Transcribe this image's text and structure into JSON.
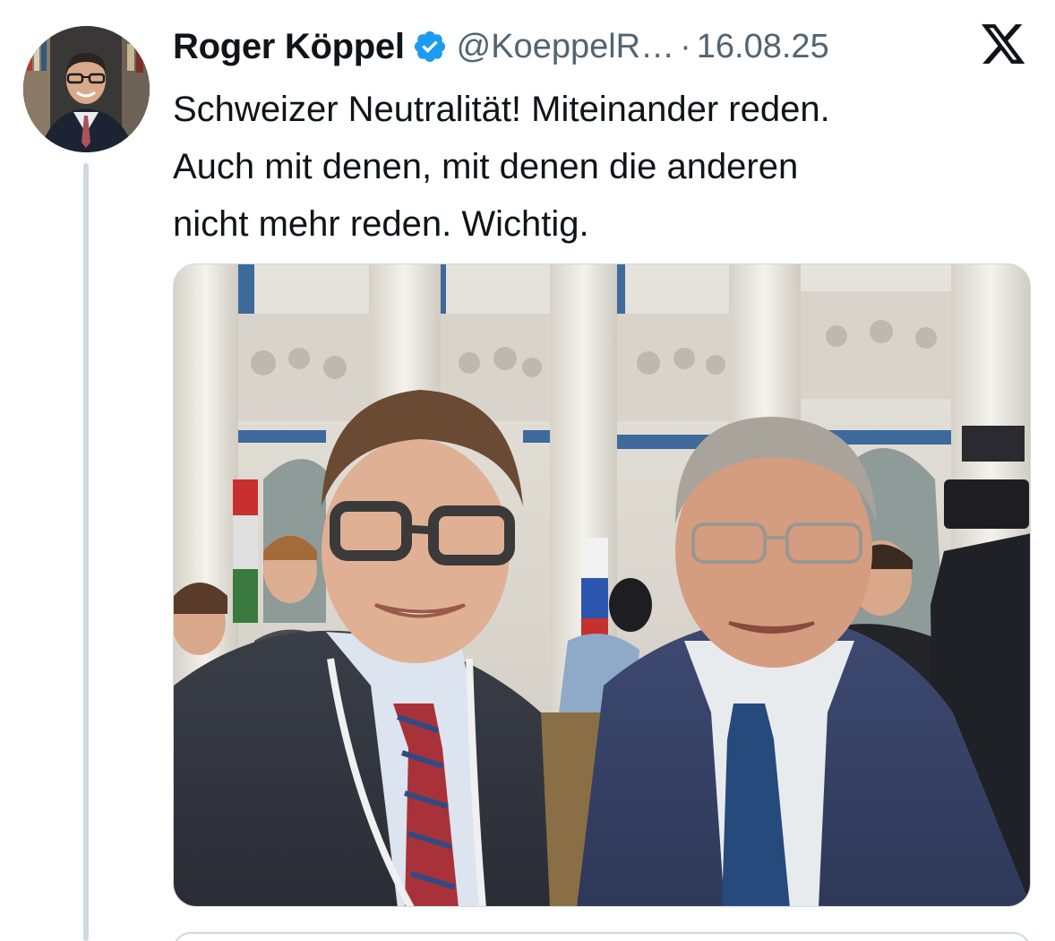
{
  "tweet": {
    "display_name": "Roger Köppel",
    "handle": "@KoeppelR…",
    "separator": "·",
    "date": "16.08.25",
    "text_lines": [
      "Schweizer Neutralität! Miteinander reden.",
      "Auch mit denen, mit denen die anderen",
      "nicht mehr reden. Wichtig."
    ]
  },
  "icons": {
    "avatar": "profile-photo",
    "verified": "verified-badge-icon",
    "platform": "x-logo-icon"
  },
  "colors": {
    "text": "#0f1419",
    "secondary_text": "#536471",
    "verified_blue": "#1d9bf0",
    "border": "#cfd9de"
  }
}
